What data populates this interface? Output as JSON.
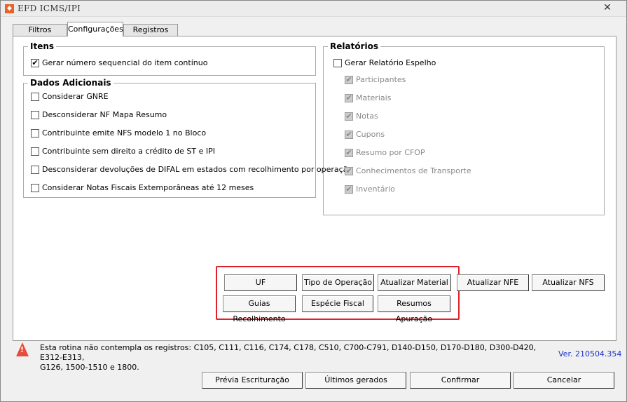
{
  "window": {
    "title": "EFD ICMS/IPI",
    "close": "✕"
  },
  "tabs": [
    {
      "label": "Filtros"
    },
    {
      "label": "Configurações"
    },
    {
      "label": "Registros"
    }
  ],
  "itens": {
    "legend": "Itens",
    "options": [
      {
        "label": "Gerar número sequencial do item contínuo",
        "checked": true
      }
    ]
  },
  "dados": {
    "legend": "Dados Adicionais",
    "options": [
      {
        "label": "Considerar GNRE",
        "checked": false
      },
      {
        "label": "Desconsiderar NF Mapa Resumo",
        "checked": false
      },
      {
        "label": "Contribuinte emite NFS modelo 1 no Bloco",
        "checked": false
      },
      {
        "label": "Contribuinte sem direito a crédito de ST e IPI",
        "checked": false
      },
      {
        "label": "Desconsiderar devoluções de DIFAL em estados com recolhimento por operação",
        "checked": false
      },
      {
        "label": "Considerar Notas Fiscais Extemporâneas até 12 meses",
        "checked": false
      }
    ]
  },
  "relatorios": {
    "legend": "Relatórios",
    "main": {
      "label": "Gerar Relatório Espelho",
      "checked": false
    },
    "sub": [
      {
        "label": "Participantes"
      },
      {
        "label": "Materiais"
      },
      {
        "label": "Notas"
      },
      {
        "label": "Cupons"
      },
      {
        "label": "Resumo por CFOP"
      },
      {
        "label": "Conhecimentos de Transporte"
      },
      {
        "label": "Inventário"
      }
    ]
  },
  "actions": {
    "uf": "UF",
    "tipo": "Tipo de Operação",
    "material": "Atualizar Material",
    "nfe": "Atualizar NFE",
    "nfs": "Atualizar NFS",
    "guias": "Guias Recolhimento",
    "especie": "Espécie Fiscal",
    "resumos": "Resumos Apuração"
  },
  "footer": {
    "warning_line1": "Esta rotina não contempla os registros: C105, C111, C116, C174, C178, C510, C700-C791, D140-D150, D170-D180, D300-D420, E312-E313,",
    "warning_line2": "G126, 1500-1510 e 1800.",
    "version": "Ver. 210504.354"
  },
  "buttons": {
    "previa": "Prévia Escrituração",
    "ultimos": "Últimos gerados",
    "confirmar": "Confirmar",
    "cancelar": "Cancelar"
  },
  "colors": {
    "highlight": "#e0202a",
    "version": "#1a33cc",
    "warning": "#e74c3c"
  }
}
